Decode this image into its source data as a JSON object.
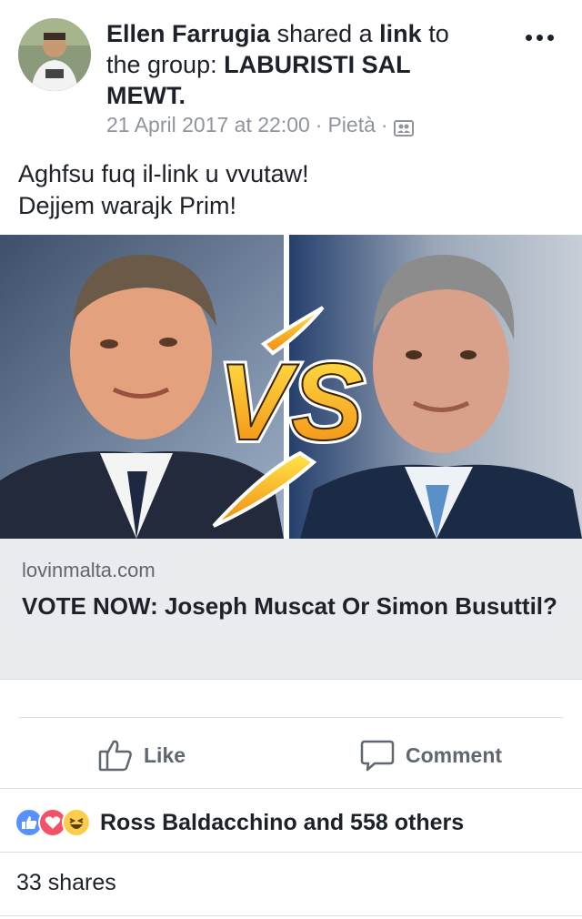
{
  "post": {
    "author": "Ellen Farrugia",
    "shared_text": "shared a",
    "link_word": "link",
    "to_text": "to the group:",
    "group_name": "LABURISTI SAL MEWT.",
    "timestamp": "21 April 2017 at 22:00",
    "separator": "·",
    "location": "Pietà",
    "audience_icon": "group-audience-icon",
    "body_line1": "Aghfsu fuq il-link u vvutaw!",
    "body_line2": "Dejjem warajk Prim!"
  },
  "link": {
    "image_text": "VS",
    "domain": "lovinmalta.com",
    "title": "VOTE NOW: Joseph Muscat Or Simon Busuttil?"
  },
  "actions": {
    "like_label": "Like",
    "comment_label": "Comment"
  },
  "reactions": {
    "icons": [
      "like-icon",
      "love-icon",
      "haha-icon"
    ],
    "summary": "Ross Baldacchino and 558 others"
  },
  "shares": {
    "label": "33 shares"
  },
  "colors": {
    "meta_text": "#90949c",
    "link_preview_bg": "#e9ebee",
    "like_blue": "#5890ff",
    "love_red": "#f25268",
    "haha_yellow": "#fccd4d"
  }
}
